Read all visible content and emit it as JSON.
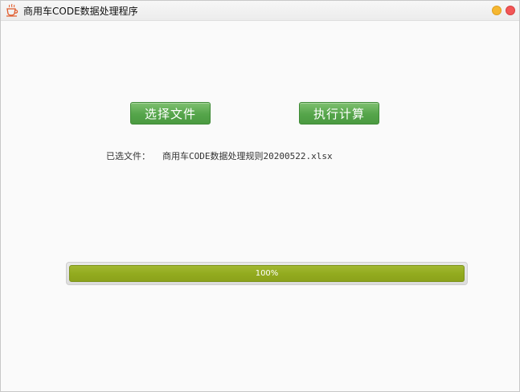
{
  "window": {
    "title": "商用车CODE数据处理程序",
    "icon": "coffee-cup-icon",
    "controls": {
      "minimize_icon": "minimize-circle-icon",
      "close_icon": "close-circle-icon",
      "minimize_color": "#f5b731",
      "close_color": "#f25656"
    }
  },
  "actions": {
    "select_file_label": "选择文件",
    "run_label": "执行计算",
    "button_color": "#55a54a"
  },
  "selection": {
    "label": "已选文件：",
    "filename": "商用车CODE数据处理规则20200522.xlsx"
  },
  "progress": {
    "value": 1.0,
    "text": "100%",
    "fill_color": "#93ab1f"
  }
}
